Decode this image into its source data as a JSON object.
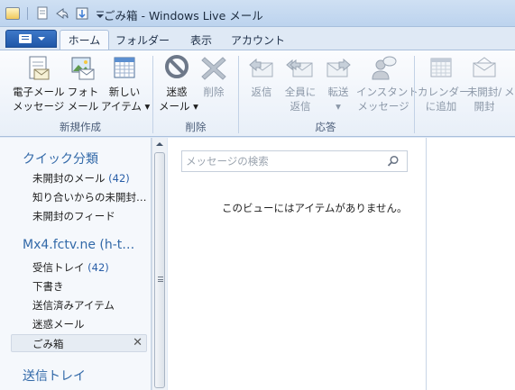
{
  "window": {
    "title": "ごみ箱 - Windows Live メール"
  },
  "tabs": [
    {
      "label": "ホーム",
      "active": true
    },
    {
      "label": "フォルダー",
      "active": false
    },
    {
      "label": "表示",
      "active": false
    },
    {
      "label": "アカウント",
      "active": false
    }
  ],
  "ribbon": {
    "new_email": {
      "line1": "電子メール",
      "line2": "メッセージ"
    },
    "photo_email": {
      "line1": "フォト",
      "line2": "メール"
    },
    "new_item": {
      "line1": "新しい",
      "line2": "アイテム ▾"
    },
    "group_new": "新規作成",
    "junk": {
      "line1": "迷惑",
      "line2": "メール ▾"
    },
    "delete": {
      "line1": "削除",
      "line2": ""
    },
    "group_delete": "削除",
    "reply": {
      "line1": "返信",
      "line2": ""
    },
    "reply_all": {
      "line1": "全員に",
      "line2": "返信"
    },
    "forward": {
      "line1": "転送",
      "line2": "▾"
    },
    "instant_message": {
      "line1": "インスタント",
      "line2": "メッセージ"
    },
    "group_respond": "応答",
    "add_calendar": {
      "line1": "カレンダー",
      "line2": "に追加"
    },
    "unread_read": {
      "line1": "未開封/",
      "line2": "開封"
    },
    "more": {
      "line1": "メ",
      "line2": ""
    }
  },
  "nav": {
    "quick_views_header": "クイック分類",
    "quick_views": [
      {
        "label": "未開封のメール",
        "count": "(42)"
      },
      {
        "label": "知り合いからの未開封…",
        "count": ""
      },
      {
        "label": "未開封のフィード",
        "count": ""
      }
    ],
    "account_header": "Mx4.fctv.ne (h-t…",
    "folders": [
      {
        "label": "受信トレイ",
        "count": "(42)"
      },
      {
        "label": "下書き",
        "count": ""
      },
      {
        "label": "送信済みアイテム",
        "count": ""
      },
      {
        "label": "迷惑メール",
        "count": ""
      },
      {
        "label": "ごみ箱",
        "count": ""
      }
    ],
    "outbox_header": "送信トレイ"
  },
  "main": {
    "search_placeholder": "メッセージの検索",
    "empty_message": "このビューにはアイテムがありません。"
  }
}
